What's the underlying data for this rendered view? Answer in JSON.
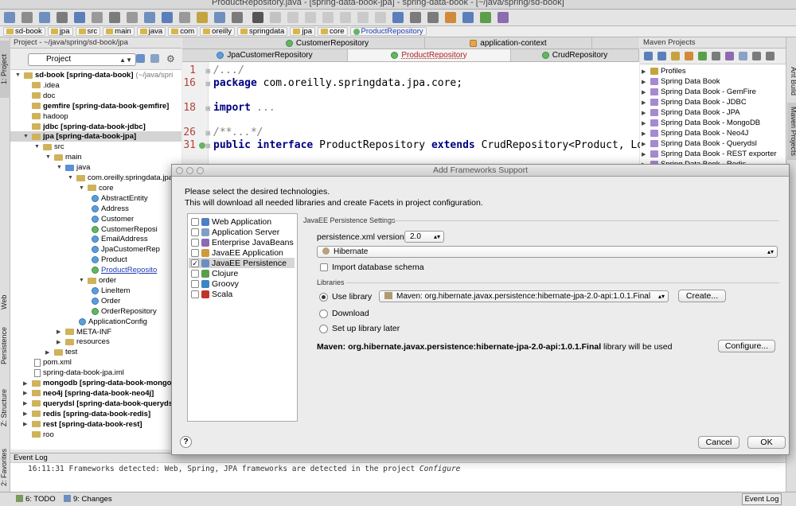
{
  "window_title": "ProductRepository.java - [spring-data-book-jpa] - spring-data-book - [~/java/spring/sd-book]",
  "breadcrumbs": [
    "sd-book",
    "jpa",
    "src",
    "main",
    "java",
    "com",
    "oreilly",
    "springdata",
    "jpa",
    "core",
    "ProductRepository"
  ],
  "project_panel": {
    "header": "Project - ~/java/spring/sd-book/jpa",
    "view_selector": "Project"
  },
  "tree": [
    {
      "label": "sd-book [spring-data-book]",
      "suffix": "(~/java/spri",
      "level": 0,
      "type": "folder",
      "expanded": true
    },
    {
      "label": ".idea",
      "level": 1,
      "type": "folder"
    },
    {
      "label": "doc",
      "level": 1,
      "type": "folder"
    },
    {
      "label": "gemfire [spring-data-book-gemfire]",
      "level": 1,
      "type": "folder"
    },
    {
      "label": "hadoop",
      "level": 1,
      "type": "folder"
    },
    {
      "label": "jdbc [spring-data-book-jdbc]",
      "level": 1,
      "type": "folder"
    },
    {
      "label": "jpa [spring-data-book-jpa]",
      "level": 1,
      "type": "folder",
      "expanded": true,
      "selected": true
    },
    {
      "label": "src",
      "level": 2,
      "type": "folder",
      "expanded": true
    },
    {
      "label": "main",
      "level": 3,
      "type": "folder",
      "expanded": true
    },
    {
      "label": "java",
      "level": 4,
      "type": "src",
      "expanded": true
    },
    {
      "label": "com.oreilly.springdata.jpa",
      "level": 5,
      "type": "folder",
      "expanded": true
    },
    {
      "label": "core",
      "level": 6,
      "type": "folder",
      "expanded": true
    },
    {
      "label": "AbstractEntity",
      "level": 7,
      "type": "class"
    },
    {
      "label": "Address",
      "level": 7,
      "type": "class"
    },
    {
      "label": "Customer",
      "level": 7,
      "type": "class"
    },
    {
      "label": "CustomerReposi",
      "level": 7,
      "type": "interface"
    },
    {
      "label": "EmailAddress",
      "level": 7,
      "type": "class"
    },
    {
      "label": "JpaCustomerRep",
      "level": 7,
      "type": "class"
    },
    {
      "label": "Product",
      "level": 7,
      "type": "class"
    },
    {
      "label": "ProductReposito",
      "level": 7,
      "type": "interface",
      "current": true
    },
    {
      "label": "order",
      "level": 6,
      "type": "folder",
      "expanded": true
    },
    {
      "label": "LineItem",
      "level": 7,
      "type": "class"
    },
    {
      "label": "Order",
      "level": 7,
      "type": "class"
    },
    {
      "label": "OrderRepository",
      "level": 7,
      "type": "interface"
    },
    {
      "label": "ApplicationConfig",
      "level": 6,
      "type": "class"
    },
    {
      "label": "META-INF",
      "level": 4,
      "type": "folder",
      "collapsed": true
    },
    {
      "label": "resources",
      "level": 4,
      "type": "folder",
      "collapsed": true
    },
    {
      "label": "test",
      "level": 3,
      "type": "folder",
      "collapsed": true
    },
    {
      "label": "pom.xml",
      "level": 2,
      "type": "file"
    },
    {
      "label": "spring-data-book-jpa.iml",
      "level": 2,
      "type": "file"
    },
    {
      "label": "mongodb [spring-data-book-mongo",
      "level": 1,
      "type": "folder",
      "collapsed": true
    },
    {
      "label": "neo4j [spring-data-book-neo4j]",
      "level": 1,
      "type": "folder",
      "collapsed": true
    },
    {
      "label": "querydsl [spring-data-book-querydsl",
      "level": 1,
      "type": "folder",
      "collapsed": true
    },
    {
      "label": "redis [spring-data-book-redis]",
      "level": 1,
      "type": "folder",
      "collapsed": true
    },
    {
      "label": "rest [spring-data-book-rest]",
      "level": 1,
      "type": "folder",
      "collapsed": true
    },
    {
      "label": "roo",
      "level": 1,
      "type": "folder"
    }
  ],
  "editor_tabs_row1": [
    {
      "label": "CustomerRepository",
      "icon": "interface"
    },
    {
      "label": "application-context",
      "icon": "xml"
    }
  ],
  "editor_tabs_row2": [
    {
      "label": "JpaCustomerRepository",
      "icon": "class"
    },
    {
      "label": "ProductRepository",
      "icon": "interface",
      "active": true
    },
    {
      "label": "CrudRepository",
      "icon": "interface"
    }
  ],
  "code_lines": [
    {
      "num": "1",
      "parts": [
        {
          "t": "/.../",
          "c": "cm"
        }
      ]
    },
    {
      "num": "16",
      "parts": [
        {
          "t": "package ",
          "c": "kw"
        },
        {
          "t": "com.oreilly.springdata.jpa.core;",
          "c": ""
        }
      ]
    },
    {
      "num": "18",
      "parts": [
        {
          "t": "import ",
          "c": "kw"
        },
        {
          "t": "...",
          "c": "cm"
        }
      ]
    },
    {
      "num": "26",
      "parts": [
        {
          "t": "/**...*/",
          "c": "cm"
        }
      ]
    },
    {
      "num": "31",
      "parts": [
        {
          "t": "public interface ",
          "c": "kw"
        },
        {
          "t": "ProductRepository ",
          "c": ""
        },
        {
          "t": "extends ",
          "c": "kw"
        },
        {
          "t": "CrudRepository<Product, Lo",
          "c": ""
        }
      ]
    }
  ],
  "maven": {
    "header": "Maven Projects",
    "items": [
      "Profiles",
      "Spring Data Book",
      "Spring Data Book - GemFire",
      "Spring Data Book - JDBC",
      "Spring Data Book - JPA",
      "Spring Data Book - MongoDB",
      "Spring Data Book - Neo4J",
      "Spring Data Book - Querydsl",
      "Spring Data Book - REST exporter",
      "Spring Data Book - Redis"
    ]
  },
  "left_tabs": [
    "1: Project",
    "Web",
    "Persistence",
    "Z: Structure",
    "2: Favorites"
  ],
  "right_tabs": [
    "Ant Build",
    "Maven Projects"
  ],
  "dialog": {
    "title": "Add Frameworks Support",
    "line1": "Please select the desired technologies.",
    "line2": "This will download all needed libraries and create Facets in project configuration.",
    "technologies": [
      {
        "label": "Web Application",
        "checked": false,
        "color": "#4d7fc4"
      },
      {
        "label": "Application Server",
        "checked": false,
        "color": "#7f9fc6"
      },
      {
        "label": "Enterprise JavaBeans",
        "checked": false,
        "color": "#8c6bb0"
      },
      {
        "label": "JavaEE Application",
        "checked": false,
        "color": "#d09a3a"
      },
      {
        "label": "JavaEE Persistence",
        "checked": true,
        "color": "#6a8ec2",
        "selected": true
      },
      {
        "label": "Clojure",
        "checked": false,
        "color": "#5a9f4a"
      },
      {
        "label": "Groovy",
        "checked": false,
        "color": "#3b86c4"
      },
      {
        "label": "Scala",
        "checked": false,
        "color": "#c0342c"
      }
    ],
    "section_title": "JavaEE Persistence Settings",
    "version_label": "persistence.xml version:",
    "version_value": "2.0",
    "provider": "Hibernate",
    "import_schema": "Import database schema",
    "libraries_title": "Libraries",
    "use_library": "Use library",
    "library_value": "Maven: org.hibernate.javax.persistence:hibernate-jpa-2.0-api:1.0.1.Final",
    "create_btn": "Create...",
    "download": "Download",
    "setup_later": "Set up library later",
    "info_bold": "Maven: org.hibernate.javax.persistence:hibernate-jpa-2.0-api:1.0.1.Final",
    "info_rest": " library will be used",
    "configure_btn": "Configure...",
    "help": "?",
    "cancel_btn": "Cancel",
    "ok_btn": "OK"
  },
  "event_log": {
    "header": "Event Log",
    "time": "16:11:31",
    "message": "Frameworks detected: Web, Spring, JPA frameworks are detected in the project",
    "link": "Configure"
  },
  "status": {
    "todo": "6: TODO",
    "changes": "9: Changes",
    "event_log": "Event Log"
  }
}
